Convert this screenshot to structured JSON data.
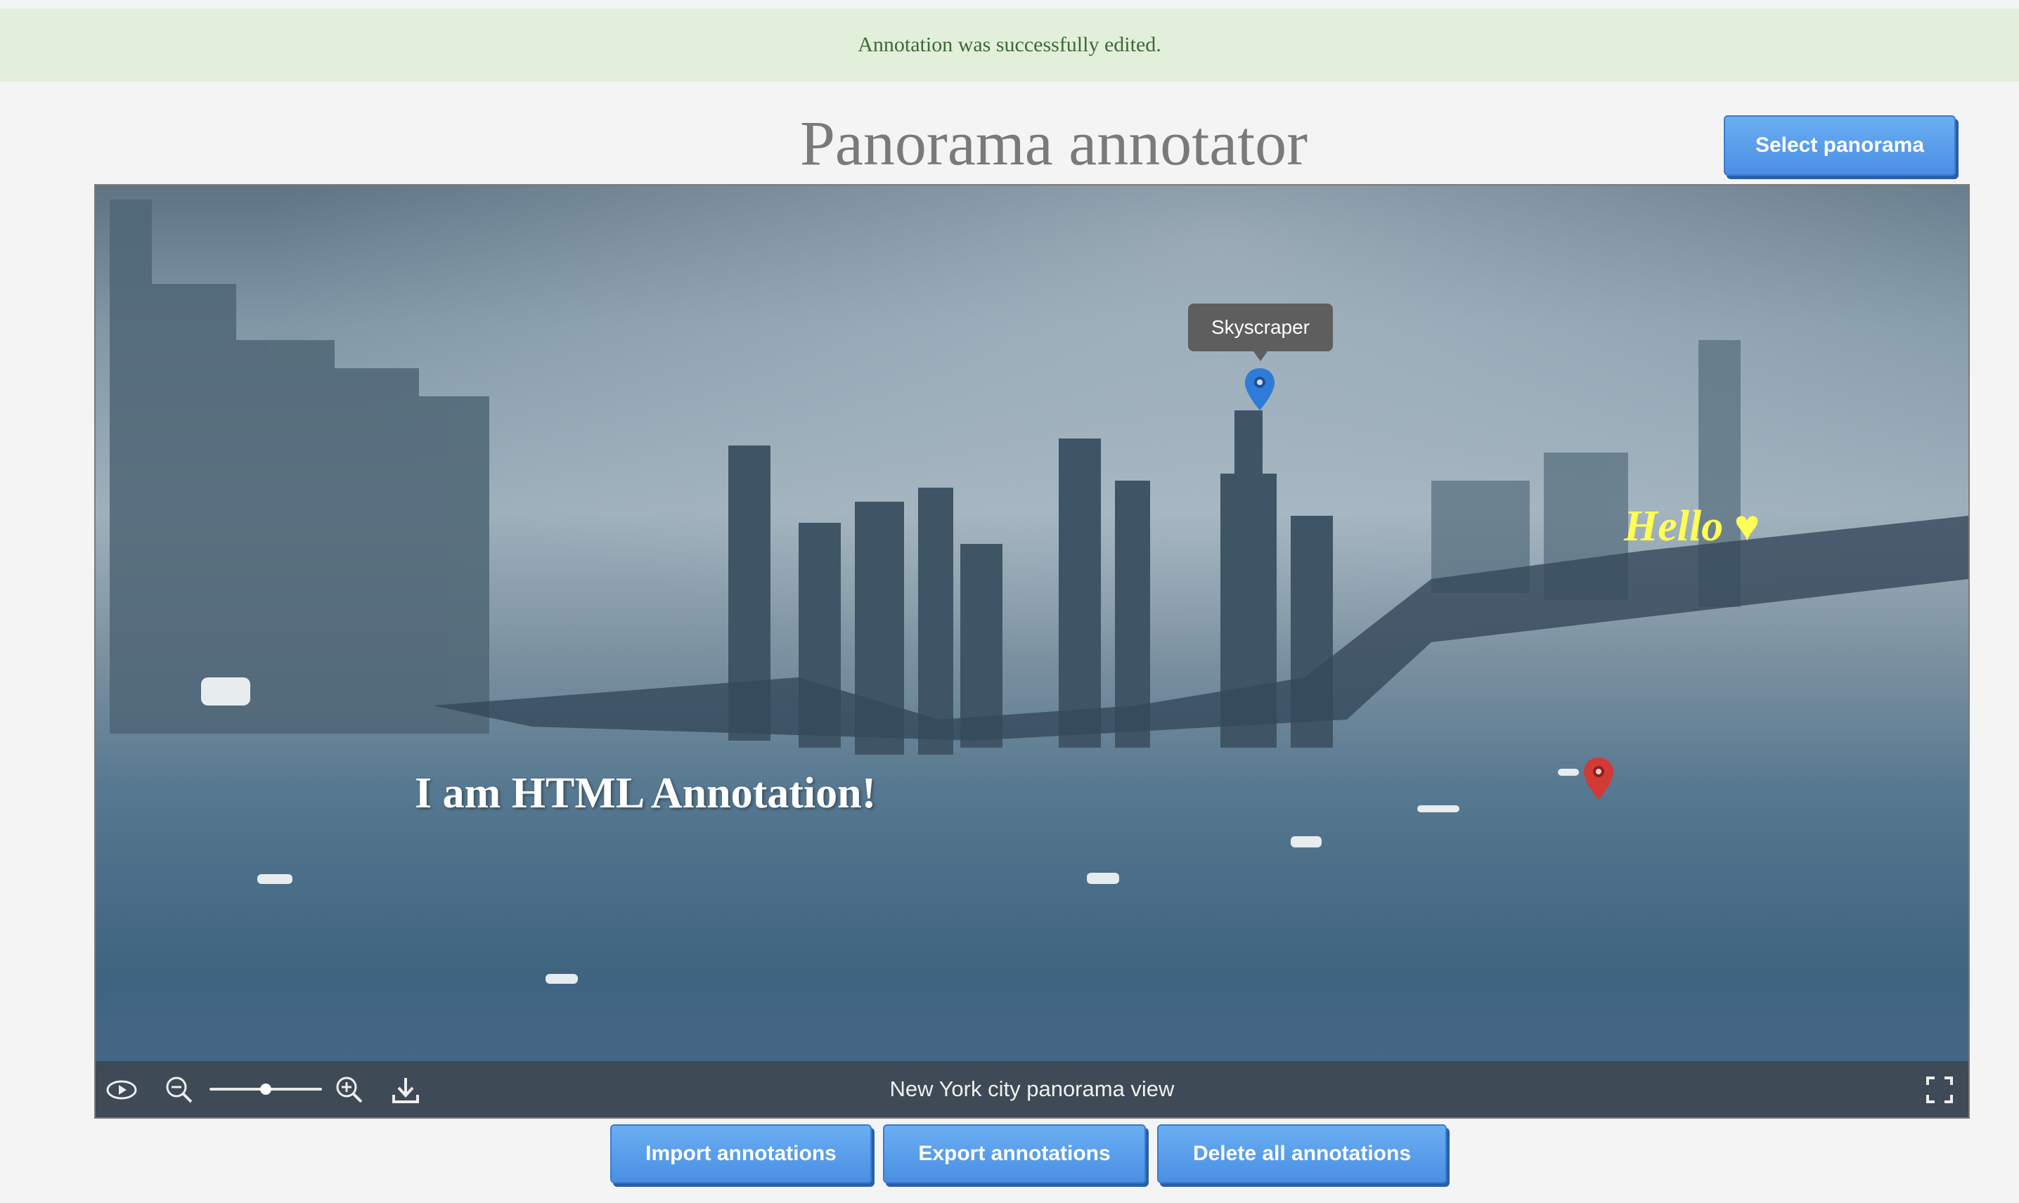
{
  "flash": {
    "message": "Annotation was successfully edited."
  },
  "header": {
    "title": "Panorama annotator",
    "select_button": "Select panorama"
  },
  "viewer": {
    "caption": "New York city panorama view",
    "zoom_level": 0.5,
    "annotations": {
      "tooltip": "Skyscraper",
      "html_text": "I am HTML Annotation!",
      "hello_text": "Hello ♥"
    },
    "colors": {
      "blue_pin": "#2f7bd8",
      "red_pin": "#d23a36"
    }
  },
  "actions": {
    "import": "Import annotations",
    "export": "Export annotations",
    "delete": "Delete all annotations"
  }
}
